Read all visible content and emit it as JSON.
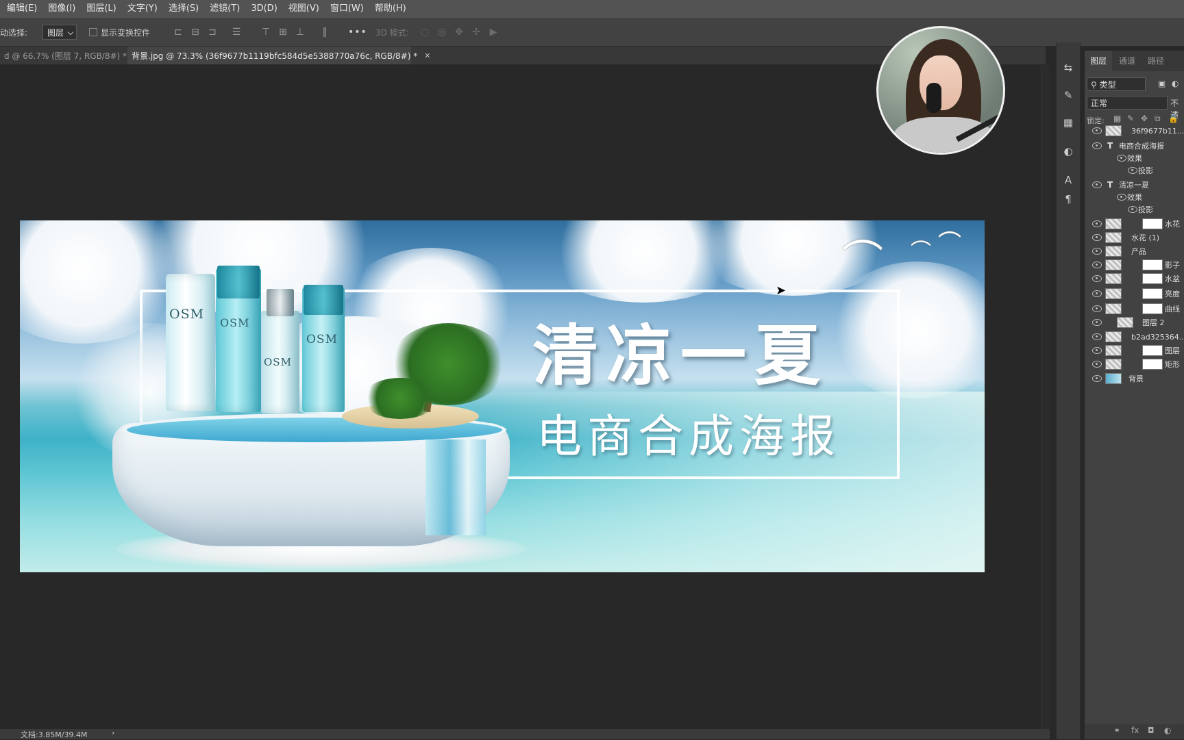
{
  "menubar": {
    "items": [
      "编辑(E)",
      "图像(I)",
      "图层(L)",
      "文字(Y)",
      "选择(S)",
      "滤镜(T)",
      "3D(D)",
      "视图(V)",
      "窗口(W)",
      "帮助(H)"
    ]
  },
  "options": {
    "auto_select_label": "动选择:",
    "auto_select_value": "图层",
    "show_transform_label": "显示变换控件",
    "more_icon": "•••",
    "mode_3d_label": "3D 模式:"
  },
  "tabs": [
    {
      "label": "d @ 66.7% (图层 7, RGB/8#) *"
    },
    {
      "label": "背景.jpg @ 73.3% (36f9677b1119bfc584d5e5388770a76c, RGB/8#) *"
    }
  ],
  "poster": {
    "headline": "清凉一夏",
    "subline": "电商合成海报",
    "brand": "OSM"
  },
  "panel": {
    "tabs": [
      "图层",
      "通道",
      "路径"
    ],
    "filter_value": "类型",
    "blend_mode": "正常",
    "opacity_label": "不透",
    "lock_label": "锁定:",
    "layers": [
      {
        "name": "36f9677b11...3",
        "kind": "smart"
      },
      {
        "name": "电商合成海报",
        "kind": "text"
      },
      {
        "name": "效果",
        "kind": "effects"
      },
      {
        "name": "投影",
        "kind": "effect"
      },
      {
        "name": "清凉一夏",
        "kind": "text"
      },
      {
        "name": "效果",
        "kind": "effects"
      },
      {
        "name": "投影",
        "kind": "effect"
      },
      {
        "name": "水花",
        "kind": "masked"
      },
      {
        "name": "水花 (1)",
        "kind": "smart"
      },
      {
        "name": "产品",
        "kind": "smart"
      },
      {
        "name": "影子",
        "kind": "masked"
      },
      {
        "name": "水盆",
        "kind": "masked"
      },
      {
        "name": "亮度",
        "kind": "adjust"
      },
      {
        "name": "曲线",
        "kind": "adjust"
      },
      {
        "name": "图层 2",
        "kind": "clipped"
      },
      {
        "name": "b2ad325364...",
        "kind": "smart"
      },
      {
        "name": "图层",
        "kind": "masked"
      },
      {
        "name": "矩形",
        "kind": "masked"
      },
      {
        "name": "背景",
        "kind": "background"
      }
    ]
  },
  "status": {
    "doc_size": "文档:3.85M/39.4M",
    "arrow": "›"
  }
}
